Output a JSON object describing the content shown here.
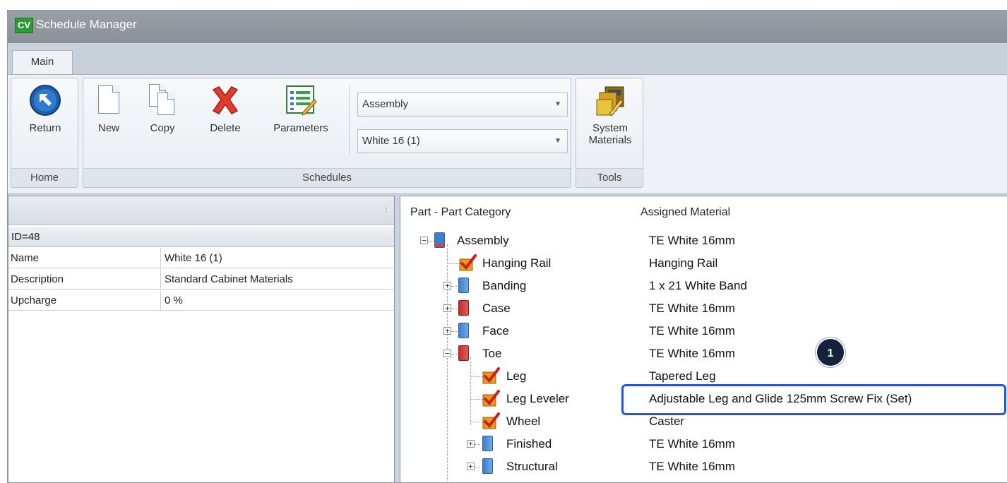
{
  "window": {
    "app_icon_text": "CV",
    "title": "Schedule Manager"
  },
  "tabs": {
    "main": "Main"
  },
  "ribbon": {
    "home": {
      "return_label": "Return",
      "group_label": "Home"
    },
    "schedules": {
      "new_label": "New",
      "copy_label": "Copy",
      "delete_label": "Delete",
      "parameters_label": "Parameters",
      "type_combo_value": "Assembly",
      "schedule_combo_value": "White 16 (1)",
      "group_label": "Schedules"
    },
    "tools": {
      "system_materials_label_1": "System",
      "system_materials_label_2": "Materials",
      "group_label": "Tools"
    }
  },
  "properties": {
    "id_row": "ID=48",
    "rows": [
      {
        "key": "Name",
        "value": "White 16 (1)"
      },
      {
        "key": "Description",
        "value": "Standard Cabinet Materials"
      },
      {
        "key": "Upcharge",
        "value": "0 %"
      }
    ]
  },
  "tree": {
    "col_part": "Part - Part Category",
    "col_material": "Assigned Material",
    "rows": [
      {
        "name": "Assembly",
        "material": "TE White 16mm",
        "icon": "multi-book-icon"
      },
      {
        "name": "Hanging Rail",
        "material": "Hanging Rail",
        "icon": "checkmark-icon"
      },
      {
        "name": "Banding",
        "material": "1 x 21 White Band",
        "icon": "blue-book-icon"
      },
      {
        "name": "Case",
        "material": "TE White 16mm",
        "icon": "red-book-icon"
      },
      {
        "name": "Face",
        "material": "TE White 16mm",
        "icon": "blue-book-icon"
      },
      {
        "name": "Toe",
        "material": "TE White 16mm",
        "icon": "red-book-icon"
      },
      {
        "name": "Leg",
        "material": "Tapered Leg",
        "icon": "checkmark-icon"
      },
      {
        "name": "Leg Leveler",
        "material": "Adjustable Leg and Glide 125mm Screw Fix (Set)",
        "icon": "checkmark-icon"
      },
      {
        "name": "Wheel",
        "material": "Caster",
        "icon": "checkmark-icon"
      },
      {
        "name": "Finished",
        "material": "TE White 16mm",
        "icon": "blue-book-icon"
      },
      {
        "name": "Structural",
        "material": "TE White 16mm",
        "icon": "blue-book-icon"
      }
    ]
  },
  "annotation": {
    "badge": "1"
  },
  "colors": {
    "callout": "#2a55d6",
    "badge": "#14223d",
    "app_icon": "#2f9a3a"
  }
}
